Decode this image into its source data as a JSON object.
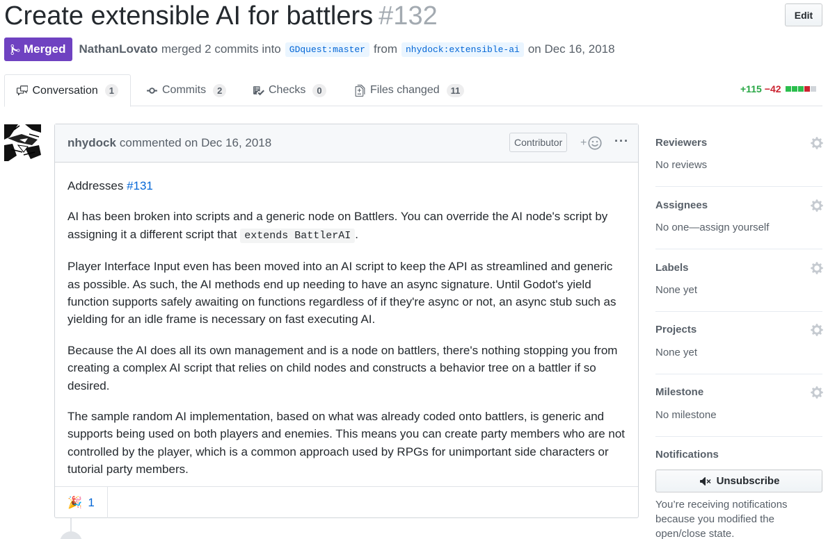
{
  "pr": {
    "title": "Create extensible AI for battlers",
    "number": "#132",
    "edit_label": "Edit",
    "state_label": "Merged",
    "author": "NathanLovato",
    "merge_text_1": "merged 2 commits into",
    "base_branch": "GDquest:master",
    "merge_text_2": "from",
    "head_branch": "nhydock:extensible-ai",
    "merge_text_3": "on Dec 16, 2018"
  },
  "tabs": [
    {
      "label": "Conversation",
      "count": "1",
      "icon": "comment-discussion-icon"
    },
    {
      "label": "Commits",
      "count": "2",
      "icon": "git-commit-icon"
    },
    {
      "label": "Checks",
      "count": "0",
      "icon": "checklist-icon"
    },
    {
      "label": "Files changed",
      "count": "11",
      "icon": "file-diff-icon"
    }
  ],
  "diffstat": {
    "additions": "+115",
    "deletions": "−42",
    "colors": {
      "add": "#2cbe4e",
      "del": "#cb2431",
      "neutral": "#d1d5da"
    }
  },
  "comment": {
    "author": "nhydock",
    "action": "commented on Dec 16, 2018",
    "role_badge": "Contributor",
    "more_label": "···",
    "addresses_prefix": "Addresses",
    "addresses_link": "#131",
    "p2_before": "AI has been broken into scripts and a generic node on Battlers. You can override the AI node's script by assigning it a different script that",
    "p2_code": "extends BattlerAI",
    "p2_after": ".",
    "p3": "Player Interface Input even has been moved into an AI script to keep the API as streamlined and generic as possible. As such, the AI methods end up needing to have an async signature. Until Godot's yield function supports safely awaiting on functions regardless of if they're async or not, an async stub such as yielding for an idle frame is necessary on fast executing AI.",
    "p4": "Because the AI does all its own management and is a node on battlers, there's nothing stopping you from creating a complex AI script that relies on child nodes and constructs a behavior tree on a battler if so desired.",
    "p5": "The sample random AI implementation, based on what was already coded onto battlers, is generic and supports being used on both players and enemies. This means you can create party members who are not controlled by the player, which is a common approach used by RPGs for unimportant side characters or tutorial party members.",
    "reaction_emoji": "🎉",
    "reaction_count": "1"
  },
  "sidebar": {
    "reviewers": {
      "label": "Reviewers",
      "value": "No reviews"
    },
    "assignees": {
      "label": "Assignees",
      "value": "No one—assign yourself"
    },
    "labels": {
      "label": "Labels",
      "value": "None yet"
    },
    "projects": {
      "label": "Projects",
      "value": "None yet"
    },
    "milestone": {
      "label": "Milestone",
      "value": "No milestone"
    },
    "notifications": {
      "label": "Notifications",
      "button": "Unsubscribe",
      "text": "You’re receiving notifications because you modified the open/close state."
    }
  },
  "colors": {
    "merged_purple": "#6f42c1",
    "link_blue": "#0366d6"
  }
}
